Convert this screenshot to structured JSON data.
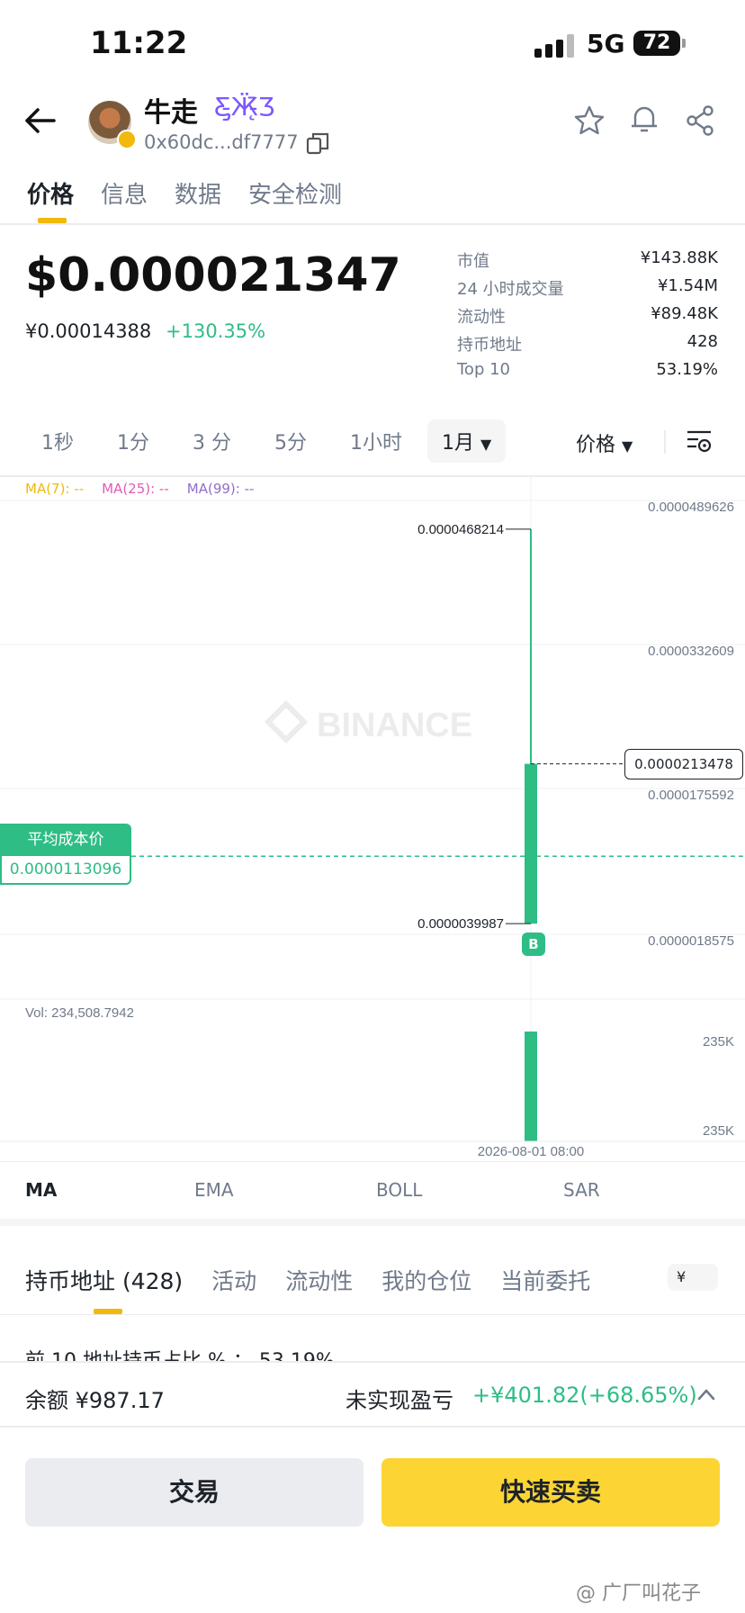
{
  "status_bar": {
    "time": "11:22",
    "network": "5G",
    "battery": "72"
  },
  "header": {
    "name": "牛走",
    "address": "0x60dc...df7777"
  },
  "tabs": [
    "价格",
    "信息",
    "数据",
    "安全检测"
  ],
  "price": {
    "usd": "$0.000021347",
    "cny": "¥0.00014388",
    "change": "+130.35%"
  },
  "stats": [
    {
      "k": "市值",
      "v": "¥143.88K"
    },
    {
      "k": "24 小时成交量",
      "v": "¥1.54M"
    },
    {
      "k": "流动性",
      "v": "¥89.48K"
    },
    {
      "k": "持币地址",
      "v": "428"
    },
    {
      "k": "Top 10",
      "v": "53.19%"
    }
  ],
  "intervals": [
    "1秒",
    "1分",
    "3 分",
    "5分",
    "1小时",
    "1月"
  ],
  "interval_selected": "1月",
  "price_selector": "价格",
  "ma_legend": [
    {
      "label": "MA(7): --",
      "color": "#f0b90b"
    },
    {
      "label": "MA(25): --",
      "color": "#e35bb5"
    },
    {
      "label": "MA(99): --",
      "color": "#8e6fc7"
    }
  ],
  "chart": {
    "y_labels": [
      "0.0000489626",
      "0.0000332609",
      "0.0000175592",
      "0.0000018575"
    ],
    "high": "0.0000468214",
    "low": "0.0000039987",
    "last": "0.0000213478",
    "avg_cost_label": "平均成本价",
    "avg_cost": "0.0000113096",
    "buy_marker": "B",
    "vol_label": "Vol: 234,508.7942",
    "vol_ticks": [
      "235K",
      "235K"
    ],
    "date": "2026-08-01 08:00",
    "watermark": "BINANCE",
    "up_color": "#2ebd85"
  },
  "chart_data": {
    "type": "candlestick",
    "x": [
      "2026-08-01 08:00"
    ],
    "open": [
      3.9987e-06
    ],
    "high": [
      4.68214e-05
    ],
    "low": [
      3.9987e-06
    ],
    "close": [
      2.13478e-05
    ],
    "volume": [
      234508.7942
    ],
    "ylim": [
      1.8575e-06,
      4.89626e-05
    ]
  },
  "indicators": [
    "MA",
    "EMA",
    "BOLL",
    "SAR"
  ],
  "holder_tabs": [
    "持币地址 (428)",
    "活动",
    "流动性",
    "我的仓位",
    "当前委托"
  ],
  "currency_toggle": "¥",
  "top10_text": "前 10 地址持币占比 % ： 53.19%",
  "bottom": {
    "balance": "余额 ¥987.17",
    "pnl_label": "未实现盈亏",
    "pnl_value": "+¥401.82(+68.65%)",
    "trade": "交易",
    "quick": "快速买卖"
  },
  "watermark_text": "@ 广厂叫花子"
}
